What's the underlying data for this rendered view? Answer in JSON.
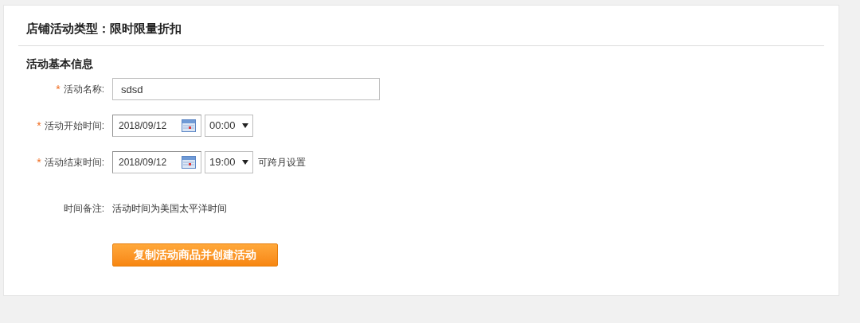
{
  "page": {
    "title": "店铺活动类型：限时限量折扣"
  },
  "section": {
    "title": "活动基本信息"
  },
  "fields": [
    {
      "kind": "text",
      "required_mark": "*",
      "label": "活动名称:",
      "value": "sdsd"
    },
    {
      "kind": "datetime",
      "required_mark": "*",
      "label": "活动开始时间:",
      "date": "2018/09/12",
      "time": "00:00"
    },
    {
      "kind": "datetime",
      "required_mark": "*",
      "label": "活动结束时间:",
      "date": "2018/09/12",
      "time": "19:00",
      "hint": "可跨月设置"
    },
    {
      "kind": "note",
      "label": "时间备注:",
      "value": "活动时间为美国太平洋时间"
    }
  ],
  "button": "复制活动商品并创建活动"
}
